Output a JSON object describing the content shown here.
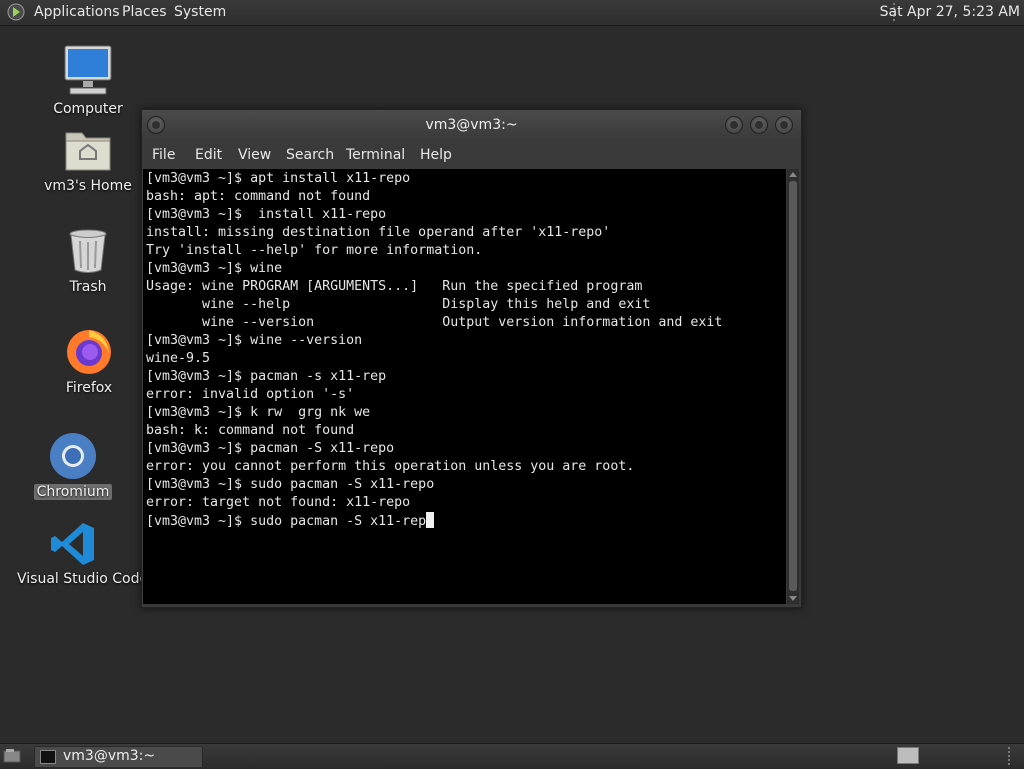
{
  "top_panel": {
    "menus": [
      "Applications",
      "Places",
      "System"
    ],
    "clock": "Sat Apr 27,  5:23 AM"
  },
  "desktop_icons": [
    {
      "label": "Computer",
      "icon": "computer-icon"
    },
    {
      "label": "vm3's Home",
      "icon": "home-folder-icon"
    },
    {
      "label": "Trash",
      "icon": "trash-icon"
    },
    {
      "label": "Firefox",
      "icon": "firefox-icon"
    },
    {
      "label": "Chromium",
      "icon": "chromium-icon",
      "selected": true
    },
    {
      "label": "Visual Studio Code",
      "icon": "vscode-icon"
    }
  ],
  "terminal": {
    "title": "vm3@vm3:~",
    "menu": [
      "File",
      "Edit",
      "View",
      "Search",
      "Terminal",
      "Help"
    ],
    "lines": [
      "[vm3@vm3 ~]$ apt install x11-repo",
      "bash: apt: command not found",
      "[vm3@vm3 ~]$  install x11-repo",
      "install: missing destination file operand after 'x11-repo'",
      "Try 'install --help' for more information.",
      "[vm3@vm3 ~]$ wine",
      "Usage: wine PROGRAM [ARGUMENTS...]   Run the specified program",
      "       wine --help                   Display this help and exit",
      "       wine --version                Output version information and exit",
      "[vm3@vm3 ~]$ wine --version",
      "wine-9.5",
      "[vm3@vm3 ~]$ pacman -s x11-rep",
      "error: invalid option '-s'",
      "[vm3@vm3 ~]$ k rw  grg nk we",
      "bash: k: command not found",
      "[vm3@vm3 ~]$ pacman -S x11-repo",
      "error: you cannot perform this operation unless you are root.",
      "[vm3@vm3 ~]$ sudo pacman -S x11-repo",
      "error: target not found: x11-repo"
    ],
    "current_input": "[vm3@vm3 ~]$ sudo pacman -S x11-rep"
  },
  "bottom_panel": {
    "task_label": "vm3@vm3:~"
  },
  "colors": {
    "desktop_bg": "#2b2b2b",
    "terminal_bg": "#000000",
    "terminal_fg": "#e6e6e6"
  }
}
